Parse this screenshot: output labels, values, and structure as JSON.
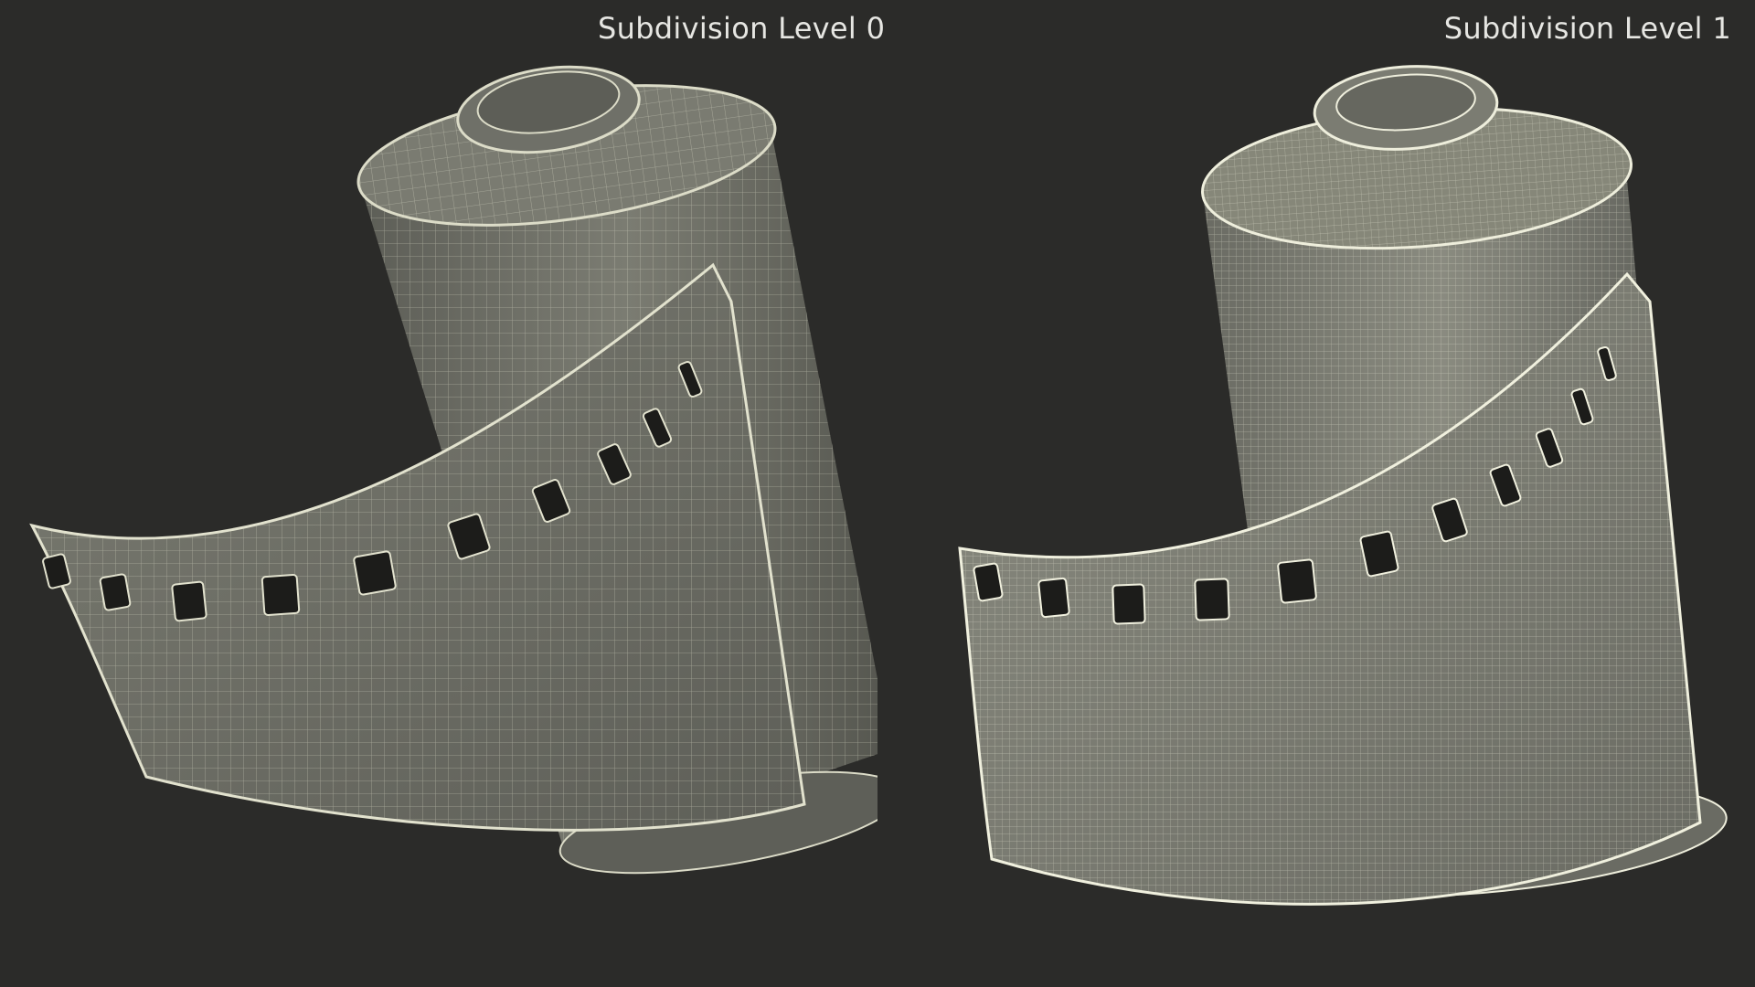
{
  "panels": [
    {
      "caption": "Subdivision Level 0",
      "wire_color": "#dcdcc8",
      "body_color": "#6e6f66"
    },
    {
      "caption": "Subdivision Level 1",
      "wire_color": "#eeeedc",
      "body_color": "#7b7c72"
    }
  ],
  "colors": {
    "background": "#2b2b29",
    "caption_text": "#e6e6e2"
  }
}
